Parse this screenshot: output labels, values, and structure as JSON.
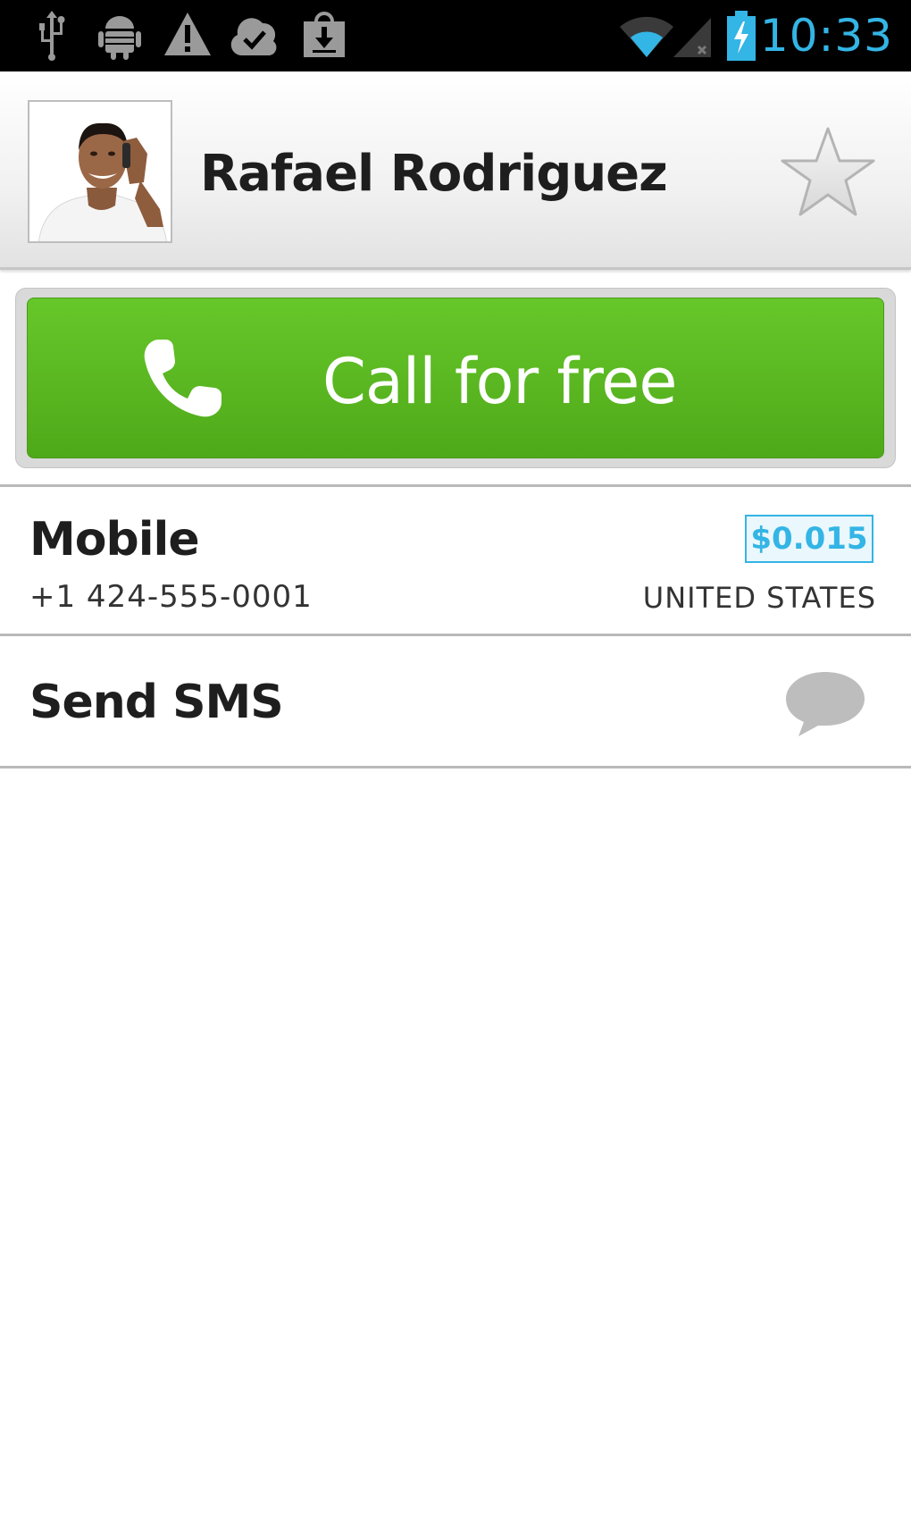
{
  "status_bar": {
    "time": "10:33",
    "icons": [
      "usb-icon",
      "android-debug-icon",
      "warning-icon",
      "cloud-check-icon",
      "download-bag-icon",
      "wifi-icon",
      "signal-icon",
      "battery-charging-icon"
    ],
    "accent_color": "#33b5e5"
  },
  "contact": {
    "name": "Rafael Rodriguez",
    "favorite": false
  },
  "call_button": {
    "label": "Call for free",
    "color": "#5bb822"
  },
  "phone_entry": {
    "type": "Mobile",
    "number": "+1 424-555-0001",
    "rate": "$0.015",
    "country": "UNITED STATES"
  },
  "sms": {
    "label": "Send SMS"
  }
}
